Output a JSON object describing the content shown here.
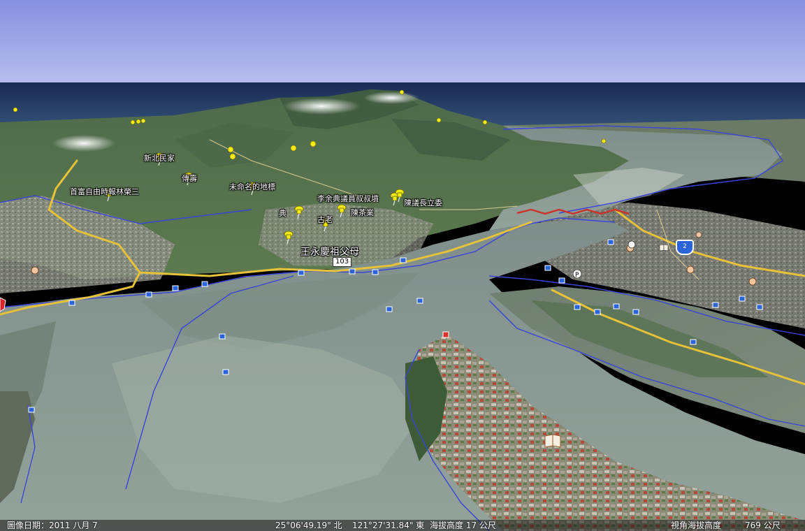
{
  "map": {
    "colors": {
      "sky_top": "#8b93e0",
      "sky_horizon": "#c9cdf0",
      "sea": "#1b2e55",
      "river": "#8a9a98",
      "shore": "#3848d8",
      "pin": "#f4ea1a",
      "road": "#e8c43a"
    },
    "placemarks": [
      {
        "name": "新北民家",
        "icon": "pushpin-icon"
      },
      {
        "name": "傳壽",
        "icon": "pushpin-icon"
      },
      {
        "name": "首富自由時報林榮三",
        "icon": "pushpin-icon"
      },
      {
        "name": "未命名的地標",
        "icon": "pushpin-icon"
      },
      {
        "name": "李余典議員叔叔墳",
        "icon": "pushpin-icon"
      },
      {
        "name": "陳議長立委",
        "icon": "pushpin-icon"
      },
      {
        "name": "典",
        "icon": "pushpin-icon"
      },
      {
        "name": "古老",
        "icon": "pushpin-icon"
      },
      {
        "name": "陳茶業",
        "icon": "pushpin-icon"
      },
      {
        "name": "王永慶祖父母",
        "icon": "pushpin-icon"
      }
    ],
    "road_shields": {
      "provincial_103": "103",
      "highway_2": "2"
    }
  },
  "status": {
    "imagery_date": "圖像日期：2011 八月 7",
    "latitude": "25°06'49.19\" 北",
    "longitude": "121°27'31.84\" 東",
    "elevation": "海拔高度   17 公尺",
    "eye_alt_label": "視角海拔高度",
    "eye_alt_value": "769 公尺"
  }
}
